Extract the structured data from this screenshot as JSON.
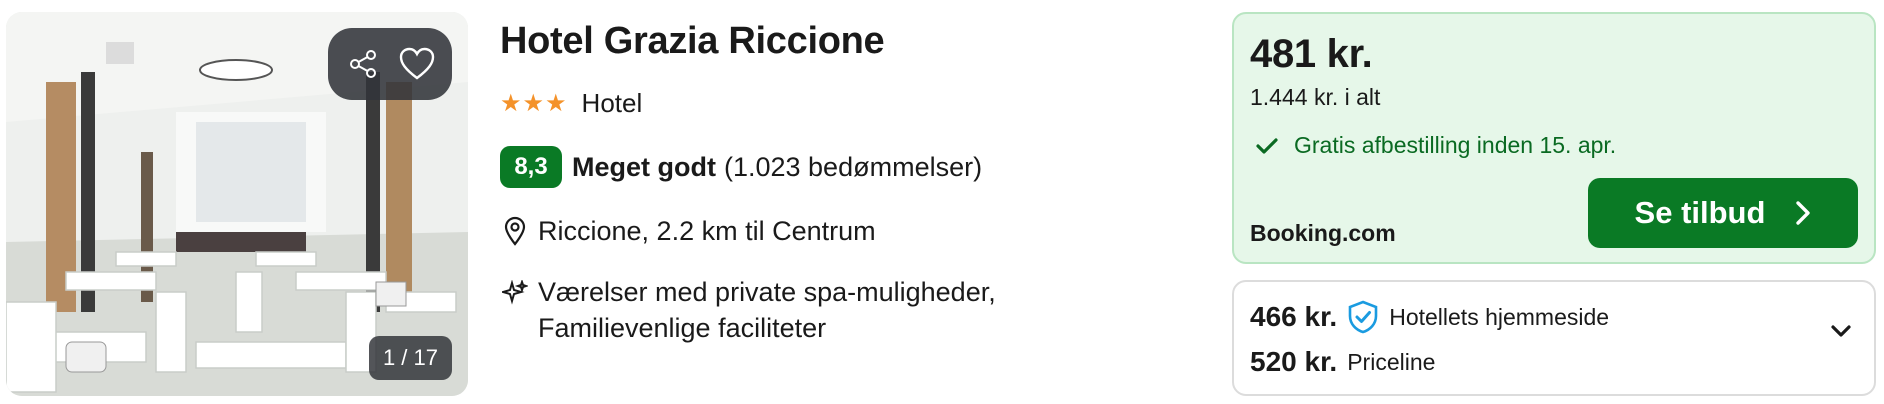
{
  "photo": {
    "counter": "1 / 17"
  },
  "hotel": {
    "name": "Hotel Grazia Riccione",
    "stars": "★★★",
    "type": "Hotel",
    "rating_score": "8,3",
    "rating_word": "Meget godt",
    "rating_count": "(1.023 bedømmelser)",
    "location": "Riccione, 2.2 km til Centrum",
    "amenities_line1": "Værelser med private spa-muligheder,",
    "amenities_line2": "Familievenlige faciliteter"
  },
  "offer": {
    "price": "481 kr.",
    "total": "1.444 kr. i alt",
    "cancellation": "Gratis afbestilling inden 15. apr.",
    "provider": "Booking.com",
    "button_label": "Se tilbud"
  },
  "other_offers": [
    {
      "price": "466 kr.",
      "source": "Hotellets hjemmeside"
    },
    {
      "price": "520 kr.",
      "source": "Priceline"
    }
  ],
  "colors": {
    "brand_green": "#0a7a25",
    "offer_bg": "#e6f7e9",
    "star_orange": "#f4922a",
    "verified_blue": "#1a9be0"
  }
}
